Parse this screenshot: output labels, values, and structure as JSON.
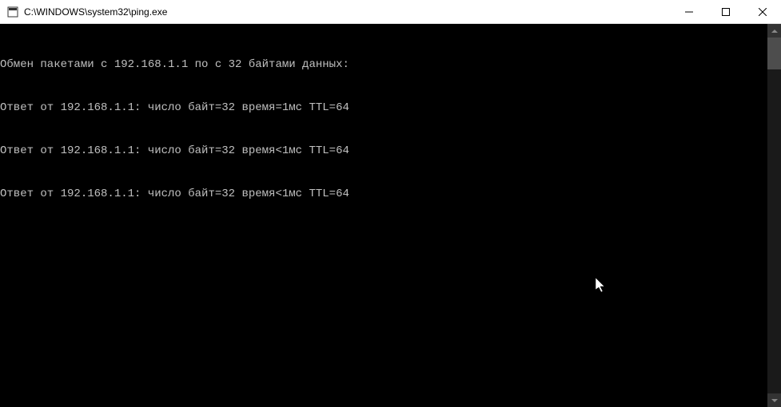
{
  "window": {
    "title": "C:\\WINDOWS\\system32\\ping.exe"
  },
  "console": {
    "lines": [
      "Обмен пакетами с 192.168.1.1 по с 32 байтами данных:",
      "Ответ от 192.168.1.1: число байт=32 время=1мс TTL=64",
      "Ответ от 192.168.1.1: число байт=32 время<1мс TTL=64",
      "Ответ от 192.168.1.1: число байт=32 время<1мс TTL=64"
    ]
  }
}
